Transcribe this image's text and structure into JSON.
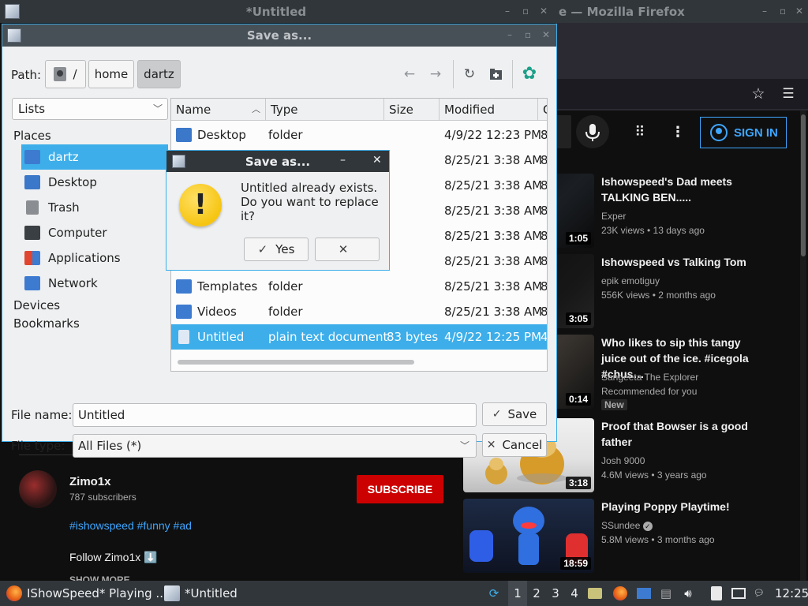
{
  "editor_window": {
    "title": "*Untitled"
  },
  "firefox_window": {
    "title_fragment": "e — Mozilla Firefox"
  },
  "youtube": {
    "sign_in_label": "SIGN IN",
    "videos": [
      {
        "title": "Ishowspeed's Dad meets TALKING BEN.....",
        "channel": "Exper",
        "stats": "23K views • 13 days ago",
        "duration": "1:05",
        "badge": ""
      },
      {
        "title": "Ishowspeed vs Talking Tom",
        "channel": "epik emotiguy",
        "stats": "556K views • 2 months ago",
        "duration": "3:05",
        "badge": ""
      },
      {
        "title": "Who likes to sip this tangy juice out of the ice. #icegola #chus…",
        "channel": "Sangeeta The Explorer",
        "stats": "Recommended for you",
        "duration": "0:14",
        "badge": "New"
      },
      {
        "title": "Proof that Bowser is a good father",
        "channel": "Josh 9000",
        "stats": "4.6M views • 3 years ago",
        "duration": "3:18",
        "badge": ""
      },
      {
        "title": "Playing Poppy Playtime!",
        "channel": "SSundee",
        "stats": "5.8M views • 3 months ago",
        "duration": "18:59",
        "badge": ""
      }
    ],
    "channel": {
      "name": "Zimo1x",
      "subscribers": "787 subscribers",
      "subscribe_label": "SUBSCRIBE",
      "hashtags": "#ishowspeed #funny #ad",
      "follow": "Follow Zimo1x ⬇️",
      "show_more": "SHOW MORE"
    }
  },
  "save_dialog": {
    "title": "Save as...",
    "path_label": "Path:",
    "breadcrumbs": [
      "/",
      "home",
      "dartz"
    ],
    "view_mode": "Lists",
    "places_header": "Places",
    "places": [
      {
        "label": "dartz",
        "icon": "home-folder-icon",
        "color": "#3d7bd1"
      },
      {
        "label": "Desktop",
        "icon": "desktop-icon",
        "color": "#3b78c9"
      },
      {
        "label": "Trash",
        "icon": "trash-icon",
        "color": "#8a8d91"
      },
      {
        "label": "Computer",
        "icon": "computer-icon",
        "color": "#3a3f44"
      },
      {
        "label": "Applications",
        "icon": "applications-icon",
        "color": "#e0462f"
      },
      {
        "label": "Network",
        "icon": "network-icon",
        "color": "#3d7bd1"
      }
    ],
    "devices_header": "Devices",
    "bookmarks_header": "Bookmarks",
    "columns": [
      "Name",
      "Type",
      "Size",
      "Modified"
    ],
    "files": [
      {
        "name": "Desktop",
        "type": "folder",
        "size": "",
        "modified": "4/9/22 12:23 PM",
        "extra": "8"
      },
      {
        "name": "",
        "type": "",
        "size": "",
        "modified": "8/25/21 3:38 AM",
        "extra": "8"
      },
      {
        "name": "",
        "type": "",
        "size": "",
        "modified": "8/25/21 3:38 AM",
        "extra": "8"
      },
      {
        "name": "",
        "type": "",
        "size": "",
        "modified": "8/25/21 3:38 AM",
        "extra": "8"
      },
      {
        "name": "",
        "type": "",
        "size": "",
        "modified": "8/25/21 3:38 AM",
        "extra": "8"
      },
      {
        "name": "",
        "type": "",
        "size": "",
        "modified": "8/25/21 3:38 AM",
        "extra": "8"
      },
      {
        "name": "Templates",
        "type": "folder",
        "size": "",
        "modified": "8/25/21 3:38 AM",
        "extra": "8"
      },
      {
        "name": "Videos",
        "type": "folder",
        "size": "",
        "modified": "8/25/21 3:38 AM",
        "extra": "8"
      },
      {
        "name": "Untitled",
        "type": "plain text document",
        "size": "83 bytes",
        "modified": "4/9/22 12:25 PM",
        "extra": "4"
      }
    ],
    "file_name_label": "File name:",
    "file_name": "Untitled",
    "file_type_label": "File type:",
    "file_type": "All Files (*)",
    "save_label": "Save",
    "cancel_label": "Cancel"
  },
  "confirm_dialog": {
    "title": "Save as...",
    "message_line1": "Untitled already exists.",
    "message_line2": "Do you want to replace it?",
    "yes_label": "Yes",
    "no_label": ""
  },
  "taskbar": {
    "task1": "IShowSpeed* Playing ...",
    "task2": "*Untitled",
    "workspaces": [
      "1",
      "2",
      "3",
      "4"
    ],
    "clock": "12:25"
  }
}
